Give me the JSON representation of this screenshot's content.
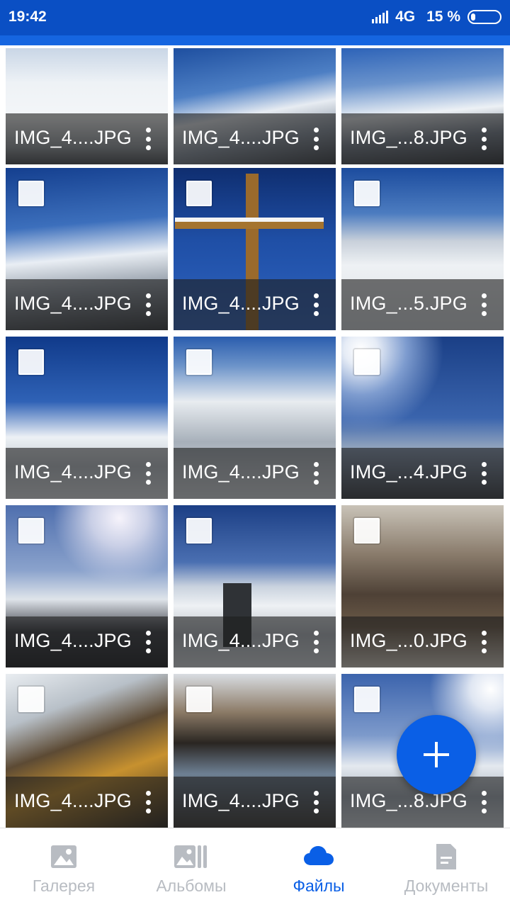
{
  "status_bar": {
    "time": "19:42",
    "network": "4G",
    "battery": "15 %"
  },
  "colors": {
    "accent": "#0a5fe6",
    "status_bar": "#0a4fc4",
    "inactive": "#b8bcc2"
  },
  "files": [
    {
      "name": "IMG_4....JPG",
      "selectable": false
    },
    {
      "name": "IMG_4....JPG",
      "selectable": false
    },
    {
      "name": "IMG_...8.JPG",
      "selectable": false
    },
    {
      "name": "IMG_4....JPG",
      "selectable": true
    },
    {
      "name": "IMG_4....JPG",
      "selectable": true
    },
    {
      "name": "IMG_...5.JPG",
      "selectable": true
    },
    {
      "name": "IMG_4....JPG",
      "selectable": true
    },
    {
      "name": "IMG_4....JPG",
      "selectable": true
    },
    {
      "name": "IMG_...4.JPG",
      "selectable": true
    },
    {
      "name": "IMG_4....JPG",
      "selectable": true
    },
    {
      "name": "IMG_4....JPG",
      "selectable": true
    },
    {
      "name": "IMG_...0.JPG",
      "selectable": true
    },
    {
      "name": "IMG_4....JPG",
      "selectable": true
    },
    {
      "name": "IMG_4....JPG",
      "selectable": true
    },
    {
      "name": "IMG_...8.JPG",
      "selectable": true
    }
  ],
  "fab": {
    "icon": "plus-icon"
  },
  "bottom_nav": {
    "items": [
      {
        "label": "Галерея",
        "icon": "gallery-icon",
        "active": false
      },
      {
        "label": "Альбомы",
        "icon": "albums-icon",
        "active": false
      },
      {
        "label": "Файлы",
        "icon": "cloud-icon",
        "active": true
      },
      {
        "label": "Документы",
        "icon": "document-icon",
        "active": false
      }
    ]
  }
}
